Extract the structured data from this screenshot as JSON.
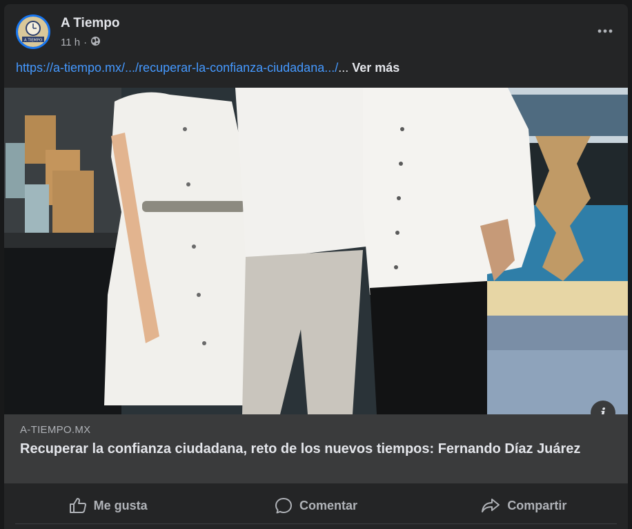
{
  "post": {
    "page_name": "A Tiempo",
    "timestamp": "11 h",
    "separator": "·",
    "audience_icon": "globe-icon",
    "link_text": "https://a-tiempo.mx/.../recuperar-la-confianza-ciudadana.../",
    "ellipsis": "...",
    "see_more": "Ver más"
  },
  "avatar": {
    "logo_text": "A TIEMPO"
  },
  "link_preview": {
    "domain": "A-TIEMPO.MX",
    "title": "Recuperar la confianza ciudadana, reto de los nuevos tiempos: Fernando Díaz Juárez"
  },
  "actions": {
    "like_label": "Me gusta",
    "comment_label": "Comentar",
    "share_label": "Compartir"
  },
  "info_glyph": "i",
  "colors": {
    "link": "#4599ff",
    "card_bg": "#242526",
    "preview_bg": "#3a3b3c",
    "secondary_text": "#b0b3b8",
    "avatar_ring": "#1877f2"
  }
}
